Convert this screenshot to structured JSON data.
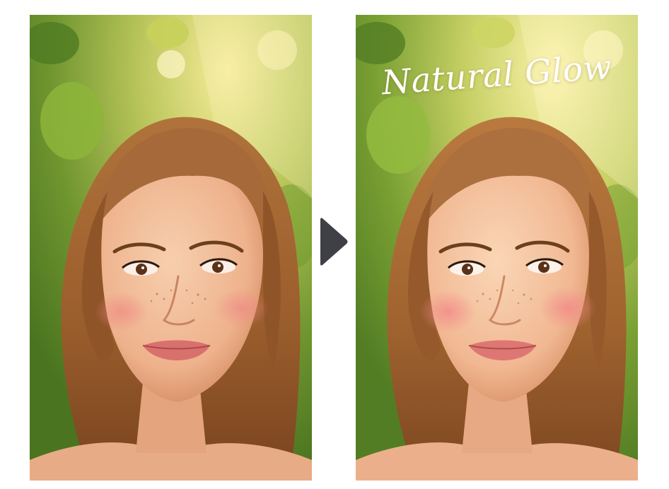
{
  "comparison": {
    "before_label": "",
    "after_caption": "Natural Glow",
    "arrow_icon": "play-triangle-icon",
    "arrow_color": "#3f3f46",
    "background": "#ffffff"
  },
  "palette": {
    "foliage_light": "#e8d77a",
    "foliage_mid": "#9fb44a",
    "foliage_dark": "#4f7a22",
    "hair": "#a56a36",
    "hair_dark": "#6e3f1c",
    "skin": "#f1bd98",
    "skin_shadow": "#d9926c",
    "blush": "#ee8a86",
    "lips": "#d8716d",
    "caption": "#ffffff"
  }
}
